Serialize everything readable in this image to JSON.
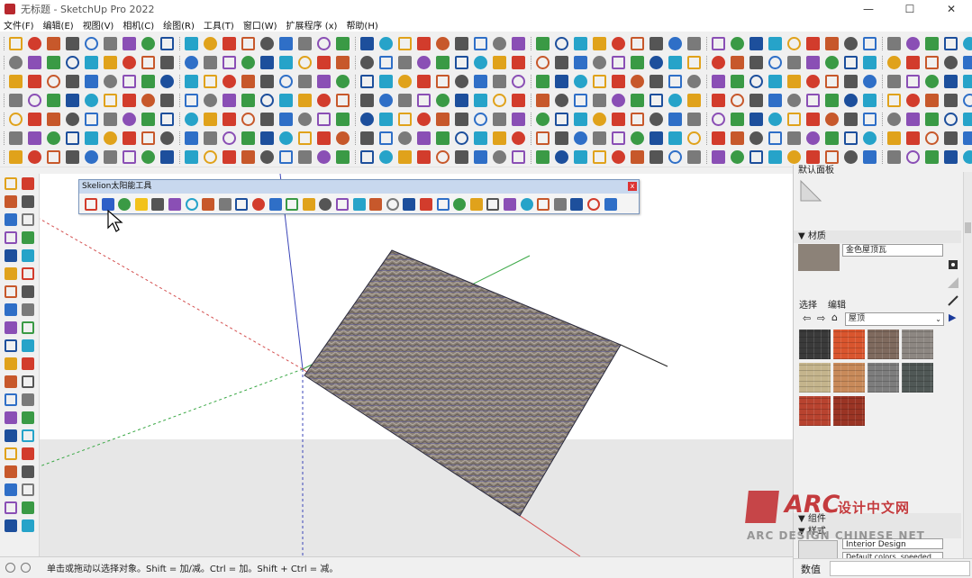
{
  "window": {
    "title": "无标题 - SketchUp Pro 2022",
    "buttons": [
      "—",
      "☐",
      "✕"
    ]
  },
  "menu": {
    "items": [
      "文件(F)",
      "编辑(E)",
      "视图(V)",
      "相机(C)",
      "绘图(R)",
      "工具(T)",
      "窗口(W)",
      "扩展程序 (x)",
      "帮助(H)"
    ]
  },
  "floating_toolbar": {
    "title": "Skelion太阳能工具",
    "close": "x"
  },
  "right_panel": {
    "default_tray": "默认面板",
    "materials_header": "材质",
    "material_name": "金色屋顶瓦",
    "tabs": [
      "选择",
      "编辑"
    ],
    "library_select": "屋顶",
    "components_header": "组件",
    "styles_header": "样式",
    "style_name": "Interior Design",
    "style_desc": "Default colors, speeded with",
    "measurements_label": "数值"
  },
  "status": {
    "hint": "单击或拖动以选择对象。Shift = 加/减。Ctrl = 加。Shift + Ctrl = 减。"
  },
  "watermark": {
    "logo_text": "ARC",
    "cn_text": "设计中文网",
    "en_text": "ARC DESIGN CHINESE NET"
  },
  "colors": {
    "accent_red": "#c0282b",
    "roof_tile": "#8c8278",
    "axis_blue": "#3b45b8",
    "axis_green": "#3aa845",
    "axis_red": "#d45050"
  }
}
